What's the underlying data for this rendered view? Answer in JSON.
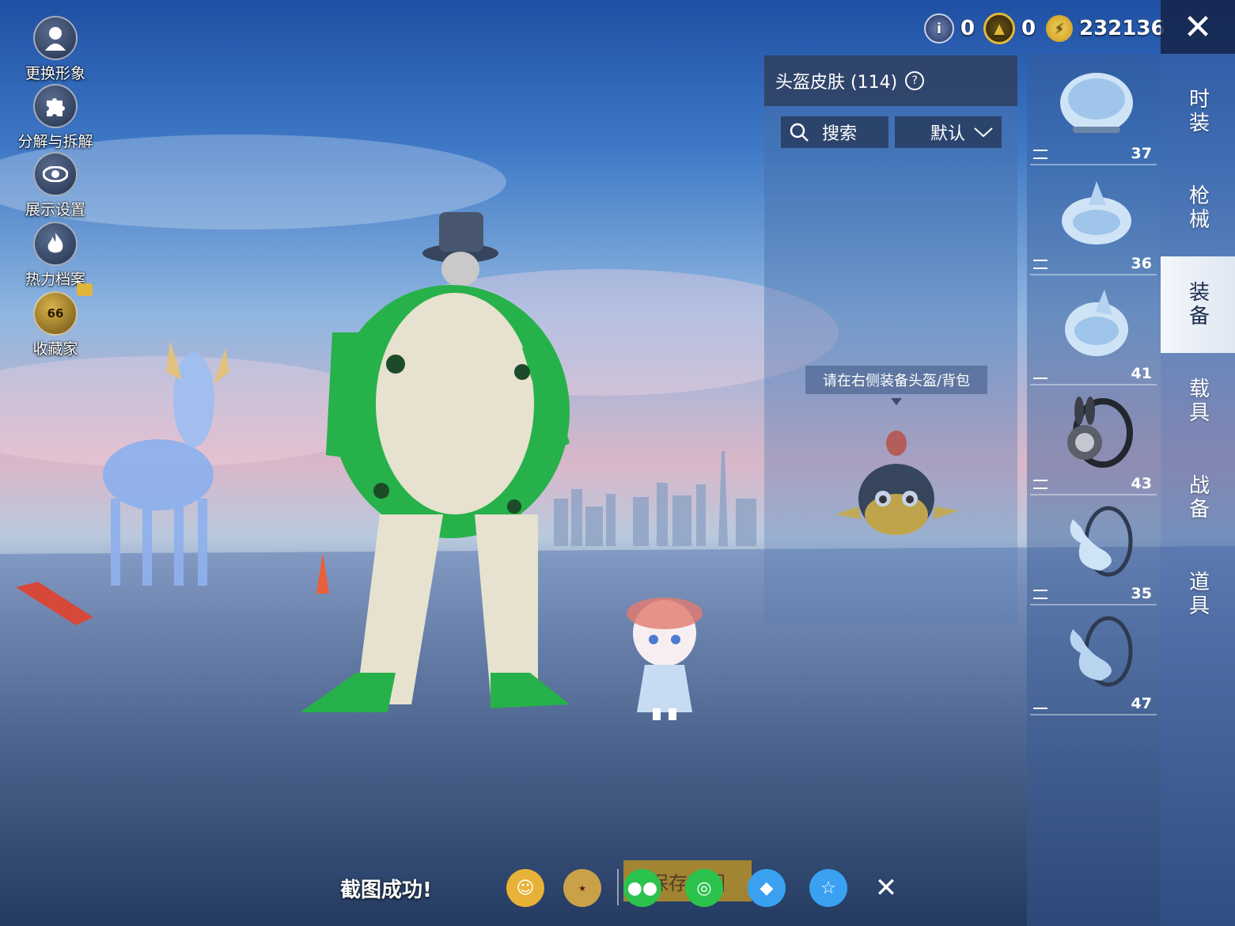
{
  "left_menu": [
    {
      "label": "更换形象",
      "icon": "avatar-icon"
    },
    {
      "label": "分解与拆解",
      "icon": "puzzle-icon"
    },
    {
      "label": "展示设置",
      "icon": "eye-icon"
    },
    {
      "label": "热力档案",
      "icon": "flame-icon"
    },
    {
      "label": "收藏家",
      "icon": "collector-badge-icon",
      "badge": "66"
    }
  ],
  "currency": [
    {
      "icon": "token-icon",
      "value": "0"
    },
    {
      "icon": "gold-coin-icon",
      "value": "0"
    },
    {
      "icon": "uc-icon",
      "value": "232136"
    }
  ],
  "panel": {
    "title": "头盔皮肤 (114)",
    "search_label": "搜索",
    "sort_label": "默认",
    "tooltip": "请在右侧装备头盔/背包"
  },
  "items": [
    {
      "count": "37"
    },
    {
      "count": "36"
    },
    {
      "count": "41"
    },
    {
      "count": "43"
    },
    {
      "count": "35"
    },
    {
      "count": "47"
    }
  ],
  "tabs": [
    {
      "label": "时装"
    },
    {
      "label": "枪械"
    },
    {
      "label": "装备",
      "active": true
    },
    {
      "label": "载具"
    },
    {
      "label": "战备"
    },
    {
      "label": "道具"
    }
  ],
  "bottom": {
    "toast": "截图成功!",
    "save_label": "保存截图",
    "share_icons": [
      "friends-icon",
      "peace-elite-icon",
      "wechat-icon",
      "moments-icon",
      "qq-icon",
      "qzone-icon",
      "close-icon"
    ]
  },
  "colors": {
    "accent": "#c99a1f",
    "active_tab": "#eef2f8",
    "panel": "#2d3c5a"
  }
}
